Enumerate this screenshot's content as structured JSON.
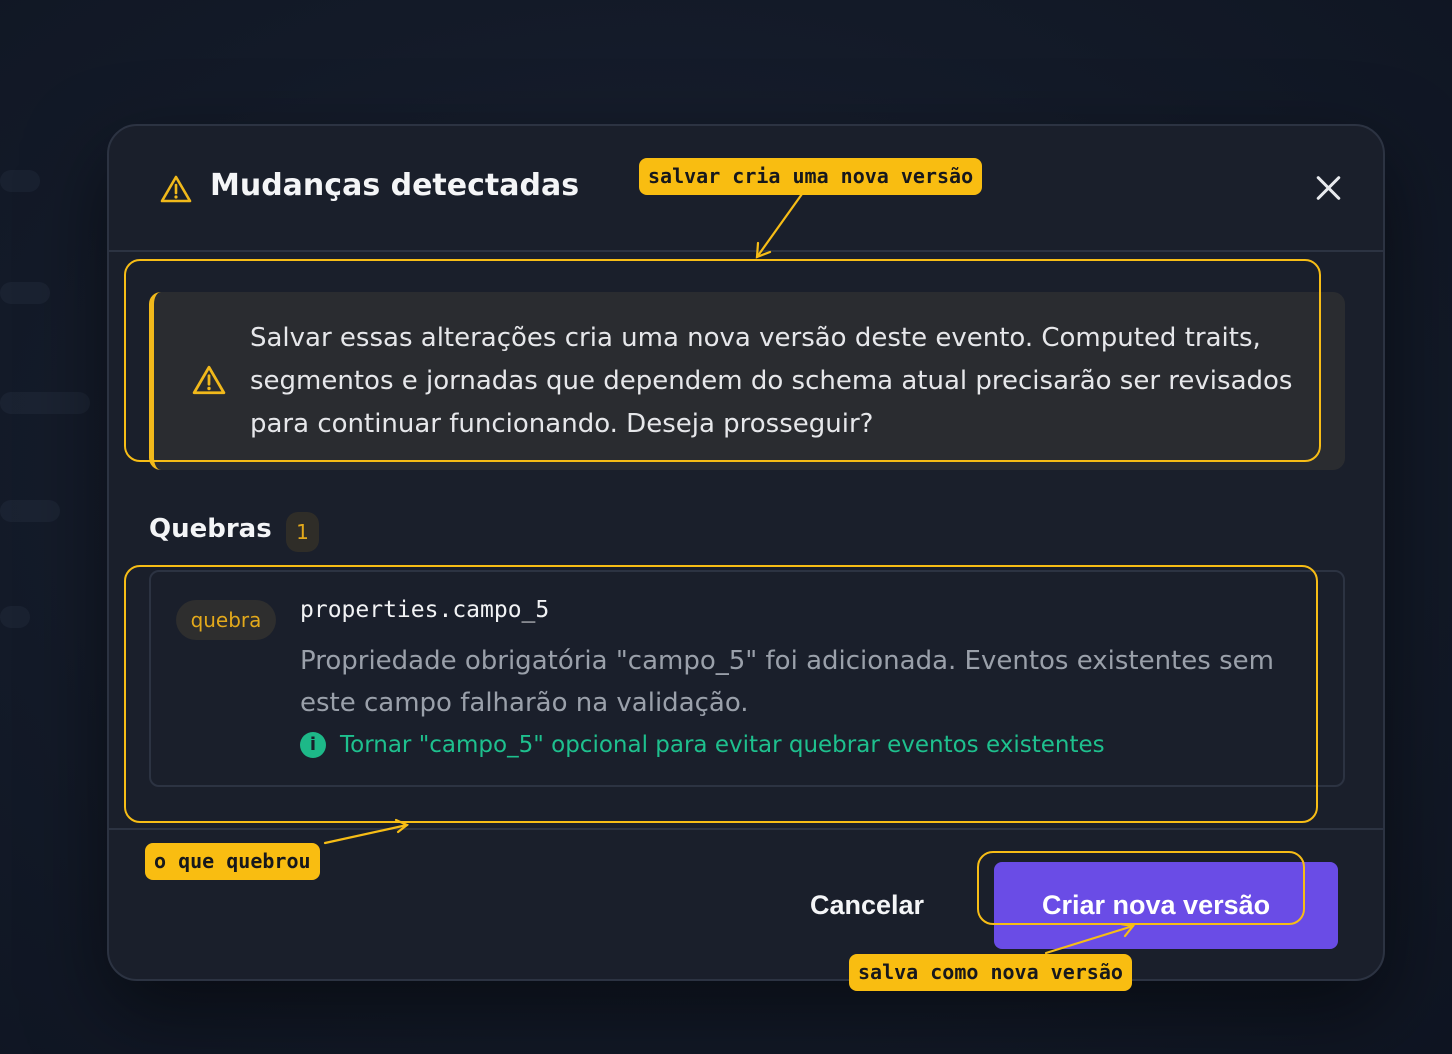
{
  "dialog": {
    "title": "Mudanças detectadas",
    "header_icon": "warning-triangle-icon",
    "close_icon": "close-icon",
    "warning": {
      "icon": "warning-triangle-icon",
      "text": "Salvar essas alterações cria uma nova versão deste evento. Computed traits, segmentos e jornadas que dependem do schema atual precisarão ser revisados para continuar funcionando. Deseja prosseguir?"
    },
    "breaks_section": {
      "title": "Quebras",
      "count": "1",
      "items": [
        {
          "tag": "quebra",
          "property": "properties.campo_5",
          "description": "Propriedade obrigatória \"campo_5\" foi adicionada. Eventos existentes sem este campo falharão na validação.",
          "suggestion_icon": "info-icon",
          "suggestion": "Tornar \"campo_5\" opcional para evitar quebrar eventos existentes"
        }
      ]
    },
    "footer": {
      "cancel_label": "Cancelar",
      "confirm_label": "Criar nova versão"
    }
  },
  "annotations": {
    "warning_note": "salvar cria uma nova versão",
    "breaks_note": "o que quebrou",
    "confirm_note": "salva como nova versão"
  },
  "colors": {
    "accent": "#6a4ce6",
    "warning": "#f1b91b",
    "success": "#1ec08e",
    "annotation": "#f9bd11"
  }
}
